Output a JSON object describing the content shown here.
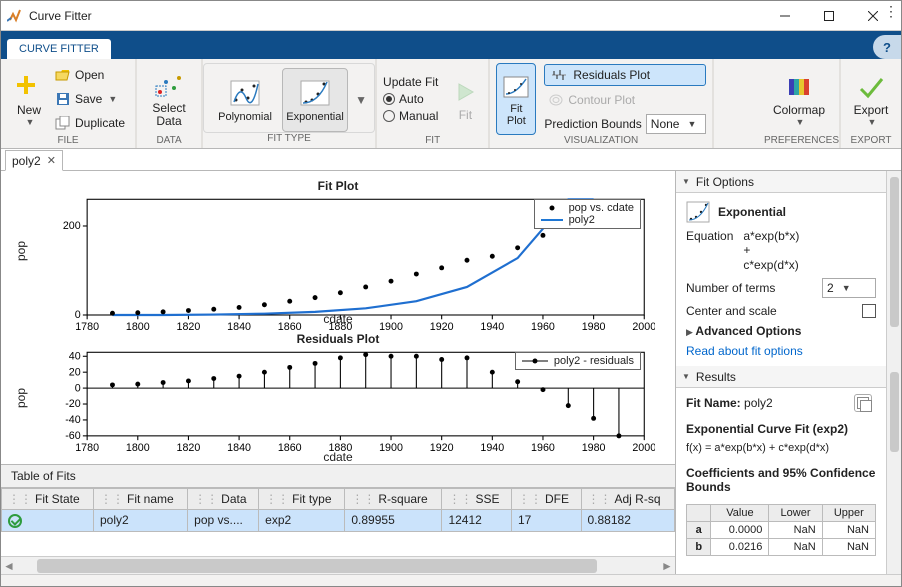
{
  "window": {
    "title": "Curve Fitter"
  },
  "tabstrip": {
    "active": "CURVE FITTER"
  },
  "ribbon": {
    "file": {
      "new": "New",
      "open": "Open",
      "save": "Save",
      "duplicate": "Duplicate",
      "label": "FILE"
    },
    "data": {
      "select": "Select\nData",
      "label": "DATA"
    },
    "fittype": {
      "poly": "Polynomial",
      "exp": "Exponential",
      "label": "FIT TYPE"
    },
    "fit": {
      "update": "Update Fit",
      "auto": "Auto",
      "manual": "Manual",
      "fit": "Fit",
      "label": "FIT"
    },
    "vis": {
      "fitplot": "Fit\nPlot",
      "residuals": "Residuals Plot",
      "contour": "Contour Plot",
      "predbounds": "Prediction Bounds",
      "predval": "None",
      "label": "VISUALIZATION"
    },
    "prefs": {
      "colormap": "Colormap",
      "label": "PREFERENCES"
    },
    "export": {
      "export": "Export",
      "label": "EXPORT"
    }
  },
  "doctab": {
    "name": "poly2"
  },
  "plots": {
    "fit": {
      "title": "Fit Plot",
      "ylabel": "pop",
      "xlabel": "cdate",
      "legend1": "pop vs. cdate",
      "legend2": "poly2"
    },
    "res": {
      "title": "Residuals Plot",
      "ylabel": "pop",
      "xlabel": "cdate",
      "legend": "poly2 - residuals"
    }
  },
  "tof": {
    "title": "Table of Fits",
    "headers": [
      "Fit State",
      "Fit name",
      "Data",
      "Fit type",
      "R-square",
      "SSE",
      "DFE",
      "Adj R-sq"
    ],
    "row": {
      "name": "poly2",
      "data": "pop vs....",
      "type": "exp2",
      "r2": "0.89955",
      "sse": "12412",
      "dfe": "17",
      "adjr2": "0.88182"
    }
  },
  "fitopts": {
    "title": "Fit Options",
    "model": "Exponential",
    "eq_label": "Equation",
    "eq1": "a*exp(b*x)",
    "eq_plus": "+",
    "eq2": "c*exp(d*x)",
    "nterms_label": "Number of terms",
    "nterms": "2",
    "center_label": "Center and scale",
    "adv": "Advanced Options",
    "readmore": "Read about fit options"
  },
  "results": {
    "title": "Results",
    "fitname_label": "Fit Name:",
    "fitname": "poly2",
    "modelhead": "Exponential Curve Fit (exp2)",
    "modelfx": "f(x) = a*exp(b*x) + c*exp(d*x)",
    "coef_head": "Coefficients and 95% Confidence Bounds",
    "coef_cols": [
      "",
      "Value",
      "Lower",
      "Upper"
    ],
    "coef_rows": [
      {
        "p": "a",
        "v": "0.0000",
        "lo": "NaN",
        "hi": "NaN"
      },
      {
        "p": "b",
        "v": "0.0216",
        "lo": "NaN",
        "hi": "NaN"
      }
    ]
  },
  "chart_data": [
    {
      "type": "scatter+line",
      "title": "Fit Plot",
      "xlabel": "cdate",
      "ylabel": "pop",
      "xlim": [
        1780,
        2000
      ],
      "ylim": [
        0,
        260
      ],
      "series": [
        {
          "name": "pop vs. cdate",
          "kind": "scatter",
          "x": [
            1790,
            1800,
            1810,
            1820,
            1830,
            1840,
            1850,
            1860,
            1870,
            1880,
            1890,
            1900,
            1910,
            1920,
            1930,
            1940,
            1950,
            1960,
            1970,
            1980,
            1990
          ],
          "y": [
            4,
            5,
            7,
            10,
            13,
            17,
            23,
            31,
            39,
            50,
            63,
            76,
            92,
            106,
            123,
            132,
            151,
            179,
            203,
            227,
            249
          ]
        },
        {
          "name": "poly2",
          "kind": "line",
          "x": [
            1790,
            1810,
            1830,
            1850,
            1870,
            1890,
            1910,
            1930,
            1950,
            1970,
            1980
          ],
          "y": [
            0,
            0,
            1,
            3,
            7,
            15,
            31,
            63,
            128,
            260,
            360
          ]
        }
      ]
    },
    {
      "type": "stem",
      "title": "Residuals Plot",
      "xlabel": "cdate",
      "ylabel": "pop",
      "xlim": [
        1780,
        2000
      ],
      "ylim": [
        -60,
        45
      ],
      "series": [
        {
          "name": "poly2 - residuals",
          "x": [
            1790,
            1800,
            1810,
            1820,
            1830,
            1840,
            1850,
            1860,
            1870,
            1880,
            1890,
            1900,
            1910,
            1920,
            1930,
            1940,
            1950,
            1960,
            1970,
            1980,
            1990
          ],
          "y": [
            4,
            5,
            7,
            9,
            12,
            15,
            20,
            26,
            31,
            38,
            42,
            40,
            40,
            36,
            38,
            20,
            8,
            -2,
            -22,
            -38,
            -62
          ]
        }
      ]
    }
  ]
}
